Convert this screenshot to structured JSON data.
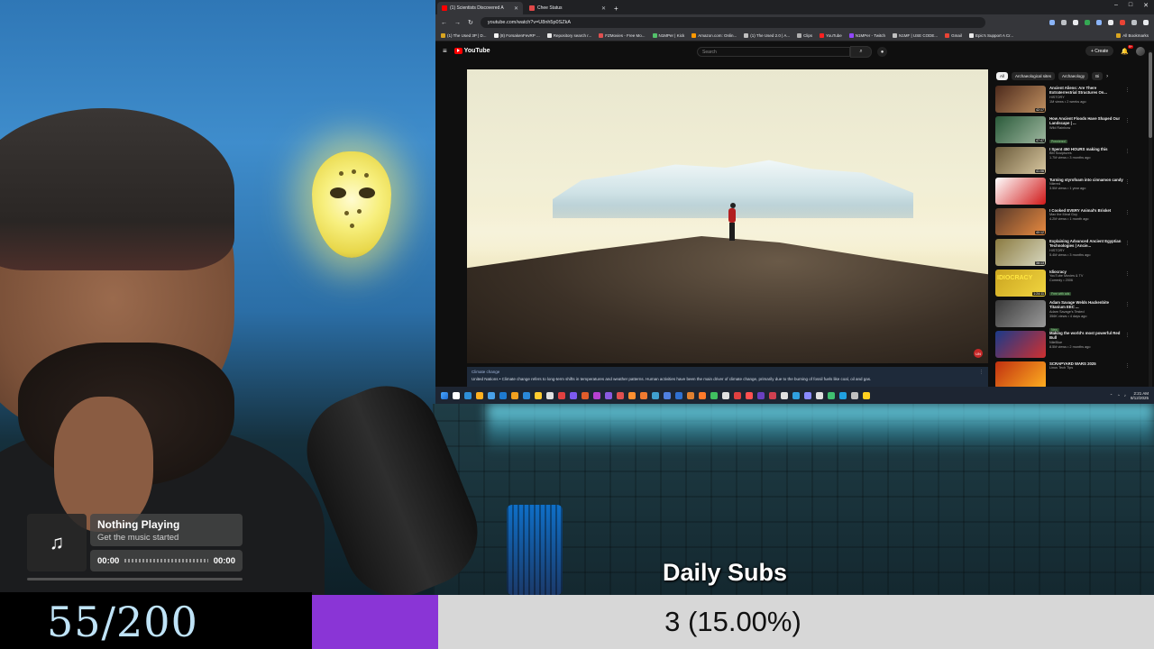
{
  "browser": {
    "tabs": [
      {
        "label": "(1) Scientists Discovered A",
        "active": true,
        "favicon_color": "#ff0000"
      },
      {
        "label": "Chee Status",
        "active": false,
        "favicon_color": "#e04848"
      }
    ],
    "new_tab_label": "+",
    "window_controls": [
      "–",
      "□",
      "✕"
    ],
    "url": "youtube.com/watch?v=U8nh5p0SZkA",
    "bookmarks": [
      "(1) The Used 3P | D...",
      "(8) ForsakenFevRP ...",
      "Repository search r...",
      "FZMovies - Free Mo...",
      "N1MPer | Kick",
      "Amazon.com: Onlin...",
      "(1) The Used 2.0 | A...",
      "Clips",
      "YouTube",
      "N1MPer - Twitch",
      "N1MF | USE CODE...",
      "Gmail",
      "Epic's Support A Cr..."
    ],
    "all_bookmarks_label": "All Bookmarks"
  },
  "youtube": {
    "logo_text": "YouTube",
    "search_placeholder": "Search",
    "create_label": "+ Create",
    "notif_count": "9+",
    "info_panel": {
      "topic": "Climate change",
      "text": "United Nations • Climate change refers to long-term shifts in temperatures and weather patterns. Human activities have been the main driver of climate change, primarily due to the burning of fossil fuels like coal, oil and gas."
    },
    "chips": [
      "All",
      "Archaeological sites",
      "Archaeology",
      "Bi"
    ],
    "recommendations": [
      {
        "title": "Ancient Aliens: Are There Extraterrestrial Structures On...",
        "channel": "HISTORY",
        "views": "1M views • 2 weeks ago",
        "badge": "",
        "duration": "42:17",
        "thumb_text": "",
        "thumb_colors": [
          "#4d2a1c",
          "#c09060"
        ]
      },
      {
        "title": "How Ancient Floods Have Shaped Our Landscape | ...",
        "channel": "Wild Rainbow",
        "views": "",
        "badge": "Premiered",
        "duration": "47:47",
        "thumb_text": "",
        "thumb_colors": [
          "#2a5a3a",
          "#9fb8a0"
        ]
      },
      {
        "title": "I Spent 450 HOURS making this",
        "channel": "BM Sculptures",
        "views": "1.7M views • 3 months ago",
        "badge": "",
        "duration": "41:06",
        "thumb_text": "",
        "thumb_colors": [
          "#6a5a3a",
          "#d8c7a0"
        ]
      },
      {
        "title": "Turning styrofoam into cinnamon candy",
        "channel": "Nilered",
        "views": "3.5M views • 1 year ago",
        "badge": "",
        "duration": "",
        "thumb_text": "",
        "thumb_colors": [
          "#ffffff",
          "#d01818"
        ]
      },
      {
        "title": "I Cooked EVERY Animal's Brisket",
        "channel": "Max the Meat Guy",
        "views": "4.2M views • 1 month ago",
        "badge": "",
        "duration": "40:12",
        "thumb_text": "",
        "thumb_colors": [
          "#5a3a2a",
          "#e88a40"
        ]
      },
      {
        "title": "Explaining Advanced Ancient Egyptian Technologies | Ancie...",
        "channel": "HISTORY",
        "views": "5.4M views • 3 months ago",
        "badge": "",
        "duration": "38:13",
        "thumb_text": "",
        "thumb_colors": [
          "#8a7a40",
          "#d8d8c0"
        ]
      },
      {
        "title": "Idiocracy",
        "channel": "YouTube Movies & TV",
        "views": "Comedy • 2006",
        "badge": "Free with ads",
        "duration": "1:24:11",
        "thumb_text": "IDIOCRACY",
        "thumb_colors": [
          "#caa420",
          "#f2d640"
        ]
      },
      {
        "title": "Adam Savage Welds Hackenbite Titanium EEC ...",
        "channel": "Adam Savage's Tested",
        "views": "356K views • 4 days ago",
        "badge": "New",
        "duration": "",
        "thumb_text": "",
        "thumb_colors": [
          "#3a3a3a",
          "#9a9a9a"
        ]
      },
      {
        "title": "Making the world's most powerful Red Bull",
        "channel": "NileBlue",
        "views": "8.5M views • 2 months ago",
        "badge": "",
        "duration": "",
        "thumb_text": "",
        "thumb_colors": [
          "#1a3a8a",
          "#d03030"
        ]
      },
      {
        "title": "SCRAPYARD WARS 2025",
        "channel": "Linus Tech Tips",
        "views": "",
        "badge": "",
        "duration": "",
        "thumb_text": "",
        "thumb_colors": [
          "#c03010",
          "#ffb020"
        ]
      }
    ]
  },
  "taskbar": {
    "icon_colors": [
      "#4aa8ff",
      "#ffffff",
      "#2e8fd8",
      "#ffb020",
      "#49a0e8",
      "#1e7ad0",
      "#f0a020",
      "#2a88d8",
      "#ffcc30",
      "#e0e0e0",
      "#e04040",
      "#7d5af0",
      "#e05c2a",
      "#b840d0",
      "#8a5ae0",
      "#e05050",
      "#ff9030",
      "#f07a30",
      "#40a0d0",
      "#5080e0",
      "#3070d0",
      "#e08030",
      "#ff7a2a",
      "#40c060",
      "#e0e0e0",
      "#e04040",
      "#ff5050",
      "#6a40c0",
      "#d04050",
      "#e0e0e0",
      "#30a0e0",
      "#8a8aff",
      "#e0e0e0",
      "#40c070",
      "#20a0e0",
      "#c0c0c0",
      "#ffd020"
    ],
    "clock_time": "2:21 AM",
    "clock_date": "8/12/2025"
  },
  "music": {
    "title": "Nothing Playing",
    "subtitle": "Get the music started",
    "time_current": "00:00",
    "time_total": "00:00",
    "progress": 0.0
  },
  "goal": {
    "count": "55/200"
  },
  "daily_subs": {
    "title": "Daily Subs",
    "value_text": "3 (15.00%)",
    "percent": 15.0
  }
}
